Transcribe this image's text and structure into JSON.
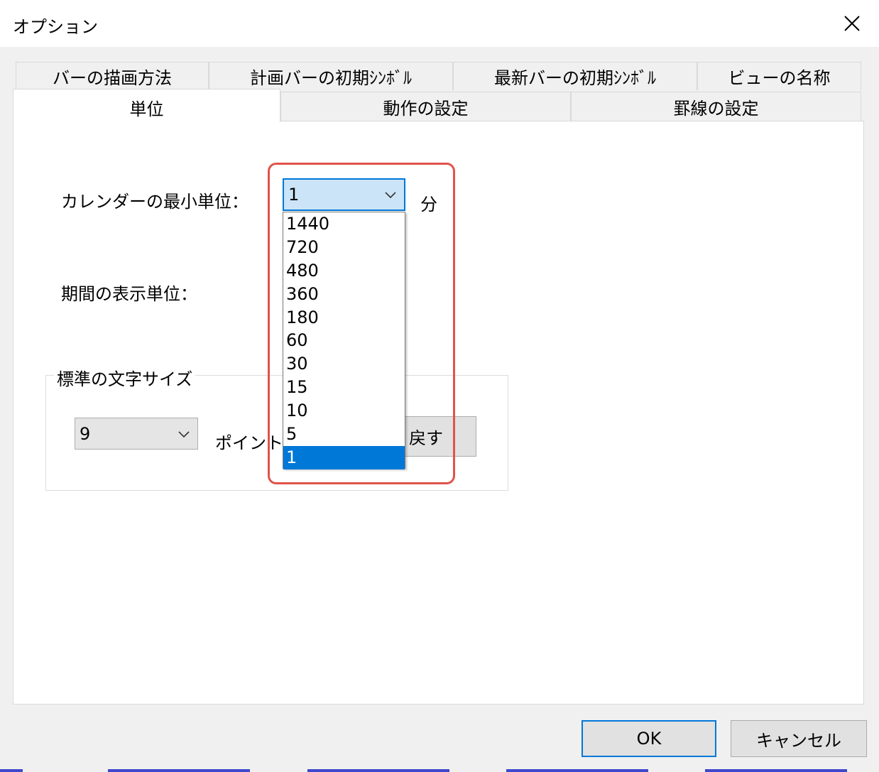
{
  "window": {
    "title": "オプション"
  },
  "tabs": {
    "row1": [
      {
        "label": "バーの描画方法"
      },
      {
        "label": "計画バーの初期ｼﾝﾎﾞﾙ"
      },
      {
        "label": "最新バーの初期ｼﾝﾎﾞﾙ"
      },
      {
        "label": "ビューの名称"
      }
    ],
    "row2": [
      {
        "label": "単位",
        "active": true
      },
      {
        "label": "動作の設定"
      },
      {
        "label": "罫線の設定"
      }
    ]
  },
  "units": {
    "calendar_label": "カレンダーの最小単位：",
    "calendar_value": "1",
    "calendar_unit": "分",
    "period_label": "期間の表示単位：",
    "dropdown_options": [
      "1440",
      "720",
      "480",
      "360",
      "180",
      "60",
      "30",
      "15",
      "10",
      "5",
      "1"
    ],
    "dropdown_selected": "1"
  },
  "font_group": {
    "legend": "標準の文字サイズ",
    "size_value": "9",
    "size_unit": "ポイント",
    "reset_label": "戻す"
  },
  "footer": {
    "ok_label": "OK",
    "cancel_label": "キャンセル"
  },
  "colors": {
    "accent": "#0078d7",
    "highlight": "#e0534a",
    "dropdown_open_bg": "#cce4f7"
  },
  "icons": {
    "close": "close-icon",
    "dropdown": "chevron-down-icon"
  }
}
